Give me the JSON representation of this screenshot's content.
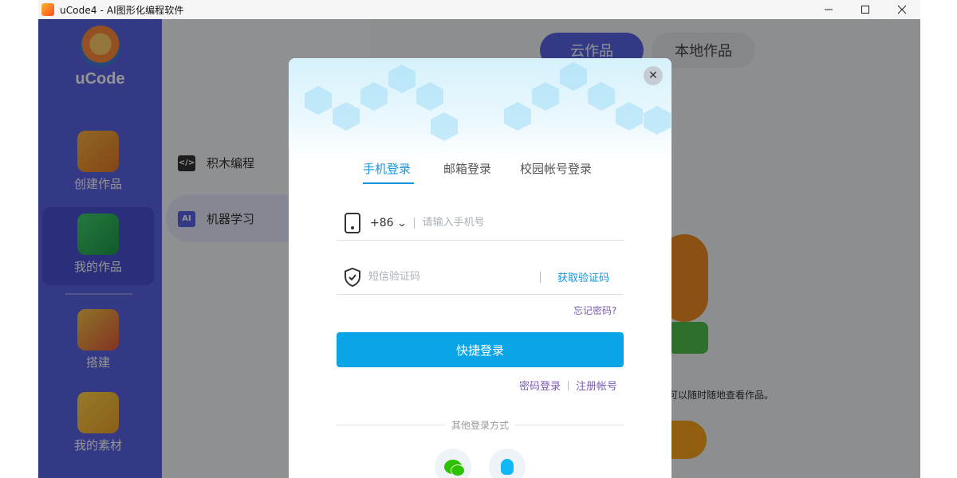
{
  "window": {
    "title": "uCode4 - AI图形化编程软件",
    "controls": [
      "minimize-icon",
      "maximize-icon",
      "close-icon"
    ]
  },
  "sidebar": {
    "logo_text": "uCode",
    "items": [
      {
        "label": "创建作品",
        "icon": "start-block-icon",
        "active": false
      },
      {
        "label": "我的作品",
        "icon": "folder-icon",
        "active": true
      },
      {
        "label": "搭建",
        "icon": "robot-icon",
        "active": false
      },
      {
        "label": "我的素材",
        "icon": "basket-icon",
        "active": false
      }
    ]
  },
  "subnav": {
    "items": [
      {
        "label": "积木编程",
        "icon": "code-icon",
        "active": false
      },
      {
        "label": "机器学习",
        "icon": "ai-icon",
        "active": true
      }
    ]
  },
  "main": {
    "tabs": [
      {
        "label": "云作品",
        "active": true
      },
      {
        "label": "本地作品",
        "active": false
      }
    ],
    "tip_text": "可以随时随地查看作品。"
  },
  "login_modal": {
    "tabs": [
      {
        "label": "手机登录",
        "active": true
      },
      {
        "label": "邮箱登录",
        "active": false
      },
      {
        "label": "校园帐号登录",
        "active": false
      }
    ],
    "phone": {
      "country_code": "+86",
      "placeholder": "请输入手机号",
      "value": ""
    },
    "sms": {
      "placeholder": "短信验证码",
      "value": "",
      "get_code_label": "获取验证码"
    },
    "forgot_label": "忘记密码?",
    "submit_label": "快捷登录",
    "password_login_label": "密码登录",
    "register_label": "注册帐号",
    "other_methods_label": "其他登录方式",
    "social": [
      "wechat-icon",
      "qq-icon"
    ],
    "colors": {
      "primary": "#0aa5e6",
      "link": "#7a5bb0",
      "sidebar": "#5b62e6"
    }
  }
}
